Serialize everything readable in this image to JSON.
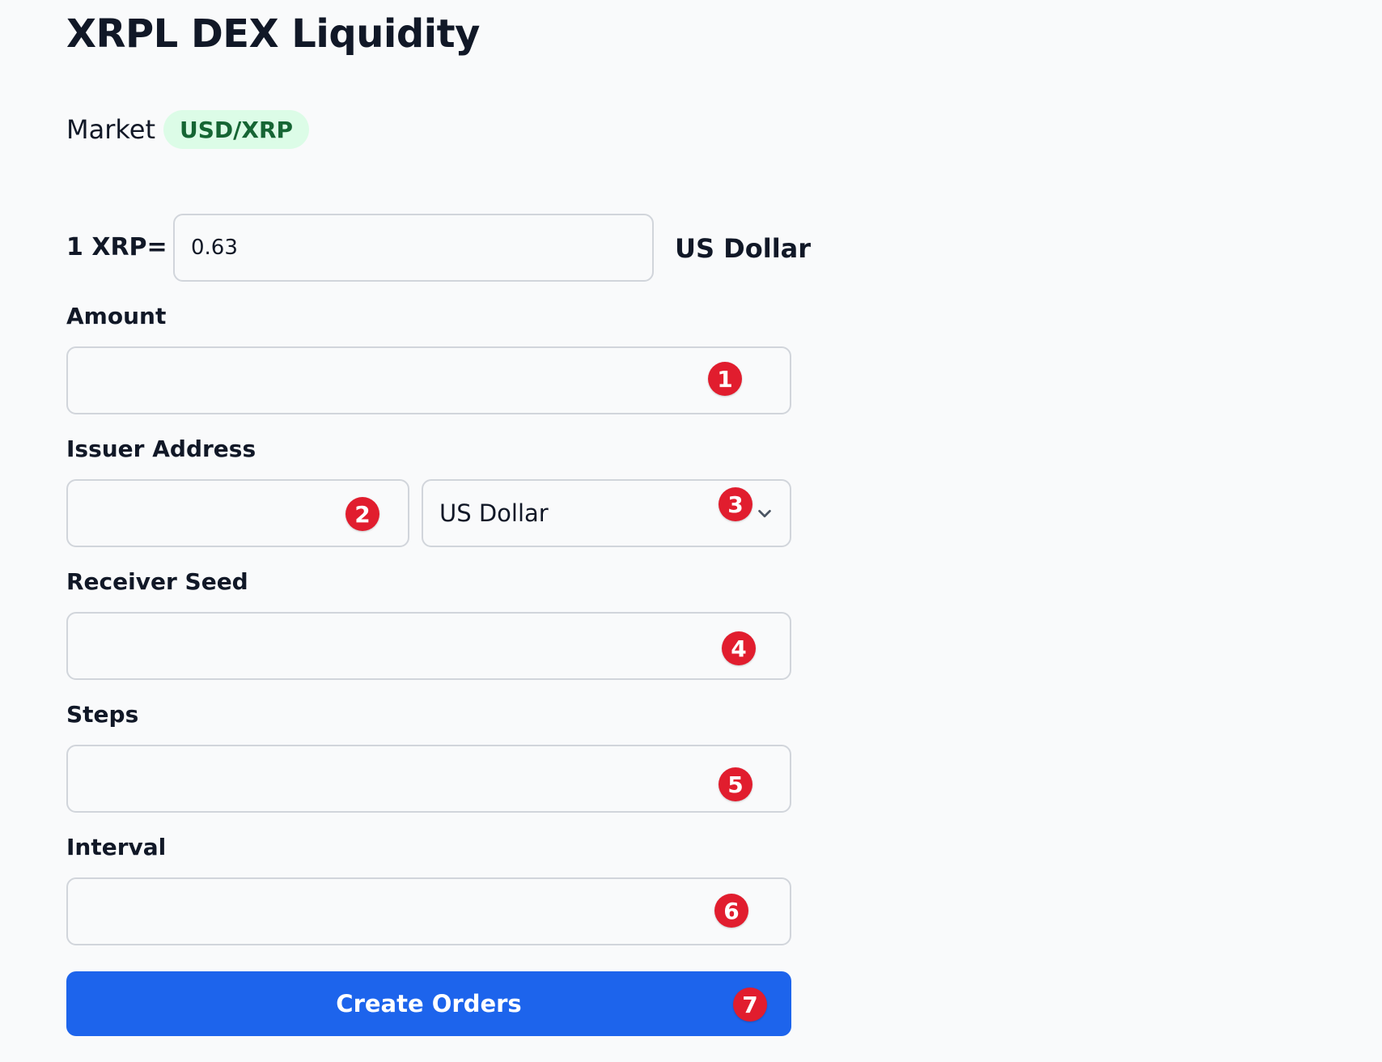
{
  "title": "XRPL DEX Liquidity",
  "market": {
    "label": "Market",
    "pair": "USD/XRP"
  },
  "rate": {
    "label": "1 XRP=",
    "value": "0.63",
    "currency": "US Dollar"
  },
  "amount": {
    "label": "Amount",
    "value": "",
    "badge": "1"
  },
  "issuer": {
    "label": "Issuer Address",
    "address_value": "",
    "address_badge": "2",
    "currency_selected": "US Dollar",
    "currency_badge": "3"
  },
  "receiver_seed": {
    "label": "Receiver Seed",
    "value": "",
    "badge": "4"
  },
  "steps": {
    "label": "Steps",
    "value": "",
    "badge": "5"
  },
  "interval": {
    "label": "Interval",
    "value": "",
    "badge": "6"
  },
  "submit": {
    "label": "Create Orders",
    "badge": "7"
  },
  "colors": {
    "accent": "#1d64ec",
    "badge": "#e11d2e",
    "market_badge_bg": "#dcfce7",
    "market_badge_text": "#166534"
  },
  "icons": {
    "select_arrow": "chevron-down-icon"
  }
}
